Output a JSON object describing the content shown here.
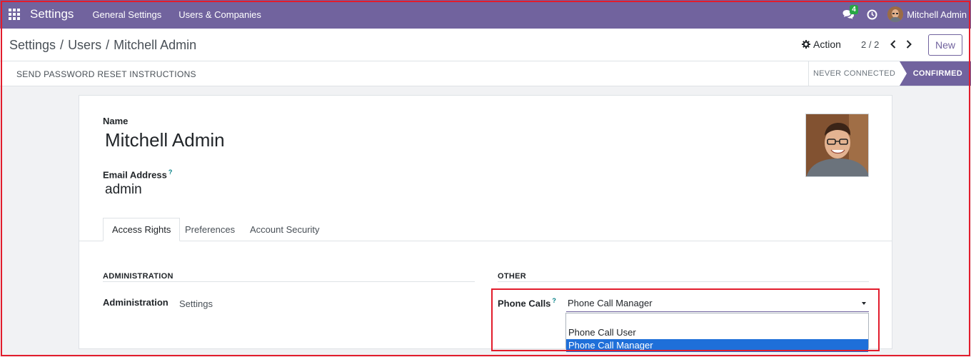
{
  "navbar": {
    "app_name": "Settings",
    "menus": [
      "General Settings",
      "Users & Companies"
    ],
    "chat_count": "4",
    "user_name": "Mitchell Admin",
    "accent_color": "#71639e"
  },
  "breadcrumb": {
    "items": [
      "Settings",
      "Users",
      "Mitchell Admin"
    ],
    "separator": "/"
  },
  "control": {
    "action_label": "Action",
    "pager_value": "2 / 2",
    "new_label": "New"
  },
  "statusbar": {
    "reset_label": "SEND PASSWORD RESET INSTRUCTIONS",
    "stages": [
      "NEVER CONNECTED",
      "CONFIRMED"
    ],
    "current_stage": "CONFIRMED"
  },
  "form": {
    "name_label": "Name",
    "name_value": "Mitchell Admin",
    "email_label": "Email Address",
    "email_help": "?",
    "email_value": "admin",
    "tabs": [
      "Access Rights",
      "Preferences",
      "Account Security"
    ],
    "active_tab": "Access Rights",
    "groups": {
      "administration_title": "ADMINISTRATION",
      "other_title": "OTHER"
    },
    "administration_label": "Administration",
    "administration_value": "Settings",
    "phone_label": "Phone Calls",
    "phone_help": "?",
    "phone_value": "Phone Call Manager",
    "phone_options": [
      "Phone Call User",
      "Phone Call Manager"
    ],
    "highlight_color": "#e21c2c"
  }
}
